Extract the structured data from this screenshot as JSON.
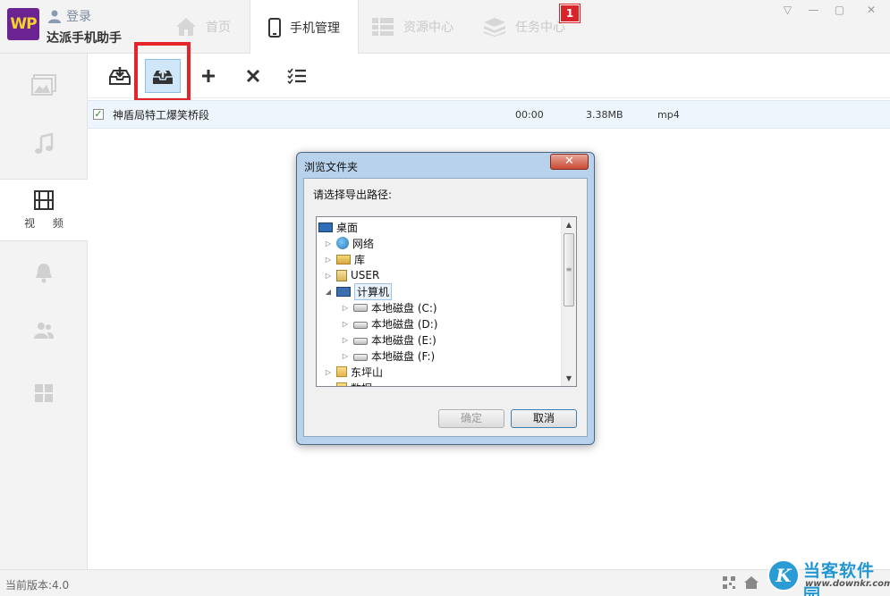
{
  "app": {
    "logo_text": "WP",
    "login_label": "登录",
    "title": "达派手机助手"
  },
  "tabs": [
    {
      "label": "首页"
    },
    {
      "label": "手机管理"
    },
    {
      "label": "资源中心"
    },
    {
      "label": "任务中心"
    }
  ],
  "task_badge": "1",
  "window_controls": {
    "menu": "▽",
    "minimize": "—",
    "maximize": "▢",
    "close": "✕"
  },
  "sidebar": {
    "active_label": "视 频",
    "items": [
      {
        "icon": "photo-icon"
      },
      {
        "icon": "music-icon"
      },
      {
        "icon": "video-icon"
      },
      {
        "icon": "bell-icon"
      },
      {
        "icon": "contacts-icon"
      },
      {
        "icon": "apps-icon"
      }
    ]
  },
  "toolbar": {
    "buttons": [
      {
        "icon": "import-icon"
      },
      {
        "icon": "export-icon"
      },
      {
        "icon": "add-icon"
      },
      {
        "icon": "delete-icon"
      },
      {
        "icon": "select-all-icon"
      }
    ]
  },
  "file": {
    "name": "神盾局特工爆笑桥段",
    "duration": "00:00",
    "size": "3.38MB",
    "type": "mp4",
    "checked": true
  },
  "dialog": {
    "title": "浏览文件夹",
    "prompt": "请选择导出路径:",
    "ok_label": "确定",
    "cancel_label": "取消",
    "tree": [
      {
        "label": "桌面",
        "icon": "desktop-icon"
      },
      {
        "label": "网络",
        "icon": "network-icon"
      },
      {
        "label": "库",
        "icon": "library-icon"
      },
      {
        "label": "USER",
        "icon": "user-folder-icon"
      },
      {
        "label": "计算机",
        "icon": "computer-icon",
        "selected": true
      },
      {
        "label": "本地磁盘 (C:)",
        "icon": "system-drive-icon"
      },
      {
        "label": "本地磁盘 (D:)",
        "icon": "drive-icon"
      },
      {
        "label": "本地磁盘 (E:)",
        "icon": "drive-icon"
      },
      {
        "label": "本地磁盘 (F:)",
        "icon": "drive-icon"
      },
      {
        "label": "东坪山",
        "icon": "folder-icon"
      },
      {
        "label": "数据",
        "icon": "folder-icon"
      }
    ]
  },
  "status": {
    "version": "当前版本:4.0"
  },
  "watermark": {
    "title": "当客软件园",
    "url": "www.downkr.com"
  }
}
